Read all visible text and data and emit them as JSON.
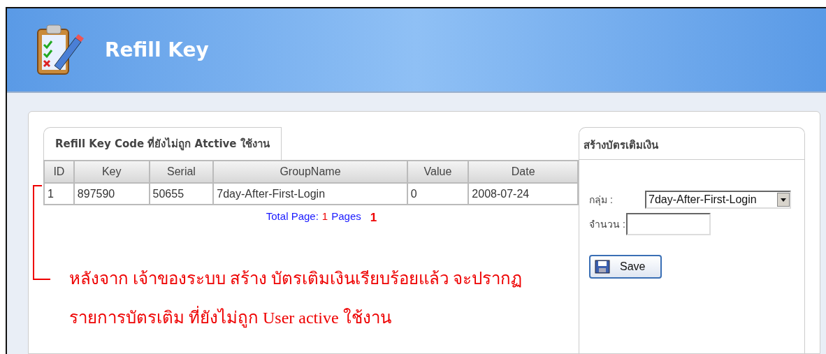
{
  "header": {
    "title": "Refill Key"
  },
  "key_list": {
    "title": "Refill Key Code ที่ยังไม่ถูก Atctive ใช้งาน",
    "table": {
      "columns": [
        "ID",
        "Key",
        "Serial",
        "GroupName",
        "Value",
        "Date"
      ],
      "rows": [
        [
          "1",
          "897590",
          "50655",
          "7day-After-First-Login",
          "0",
          "2008-07-24"
        ]
      ]
    },
    "pager": {
      "label": "Total Page:",
      "page_count": "1",
      "pages_label": "Pages",
      "pages": [
        {
          "label": "1",
          "selected": true
        }
      ]
    }
  },
  "create_form": {
    "title": "สร้างบัตรเติมเงิน",
    "group_label": "กลุ่ม :",
    "group_value": "7day-After-First-Login",
    "amount_label": "จำนวน :",
    "save_button": "Save"
  },
  "annotation": {
    "lines": [
      "หลังจาก เจ้าของระบบ สร้าง บัตรเติมเงินเรียบร้อยแล้ว จะปรากฏ",
      "รายการบัตรเติม ที่ยังไม่ถูก User active ใช้งาน"
    ]
  }
}
